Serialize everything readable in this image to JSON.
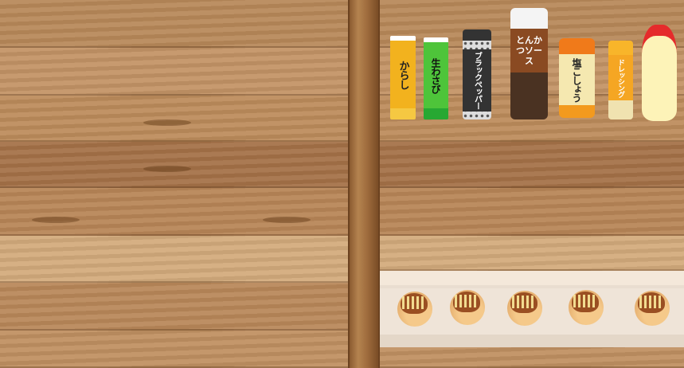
{
  "condiments": [
    {
      "id": "karashi",
      "label": "からし",
      "color": "#f2b21e"
    },
    {
      "id": "wasabi",
      "label": "生わさび",
      "color": "#3ebd3a"
    },
    {
      "id": "black-pepper",
      "label": "ブラックペッパー",
      "color": "#333333"
    },
    {
      "id": "tonkatsu-sauce",
      "label": "とんかつソース",
      "color": "#5a3a22"
    },
    {
      "id": "salt-pepper",
      "label": "塩こしょう",
      "color": "#f39a1e"
    },
    {
      "id": "dressing",
      "label": "ドレッシング",
      "color": "#f5a623"
    },
    {
      "id": "mayonnaise",
      "label": "",
      "color": "#fdf3b8"
    }
  ],
  "takoyaki_count": 5
}
